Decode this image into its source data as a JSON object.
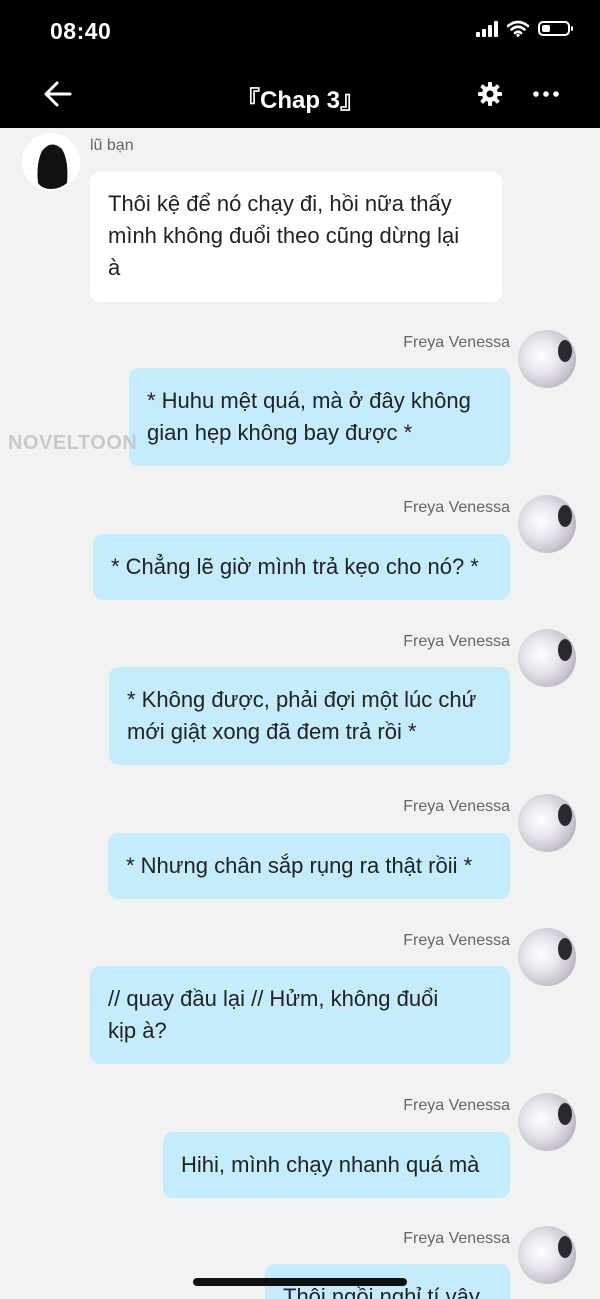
{
  "status_bar": {
    "time": "08:40",
    "battery_level": 0.35
  },
  "header": {
    "title": "『Chap 3』"
  },
  "watermark": "NOVELTOON",
  "messages": [
    {
      "sender": "lũ bạn",
      "lines": [
        "Thôi kệ để nó chạy đi, hồi nữa thấy",
        "mình không đuổi theo cũng dừng lại",
        "à"
      ]
    },
    {
      "sender": "Freya Venessa",
      "lines": [
        "* Huhu mệt quá, mà ở đây không",
        "gian hẹp không bay được *"
      ]
    },
    {
      "sender": "Freya Venessa",
      "lines": [
        "* Chẳng lẽ giờ mình trả kẹo cho nó? *"
      ]
    },
    {
      "sender": "Freya Venessa",
      "lines": [
        "* Không được, phải đợi một lúc chứ",
        "mới giật xong đã đem trả rồi *"
      ]
    },
    {
      "sender": "Freya Venessa",
      "lines": [
        "* Nhưng chân sắp rụng ra thật rồii *"
      ]
    },
    {
      "sender": "Freya Venessa",
      "lines": [
        "// quay đầu lại // Hửm, không đuổi",
        "kịp à?"
      ]
    },
    {
      "sender": "Freya Venessa",
      "lines": [
        "Hihi, mình chạy nhanh quá mà"
      ]
    },
    {
      "sender": "Freya Venessa",
      "lines": [
        "Thôi ngồi nghỉ tí vậy"
      ]
    }
  ]
}
